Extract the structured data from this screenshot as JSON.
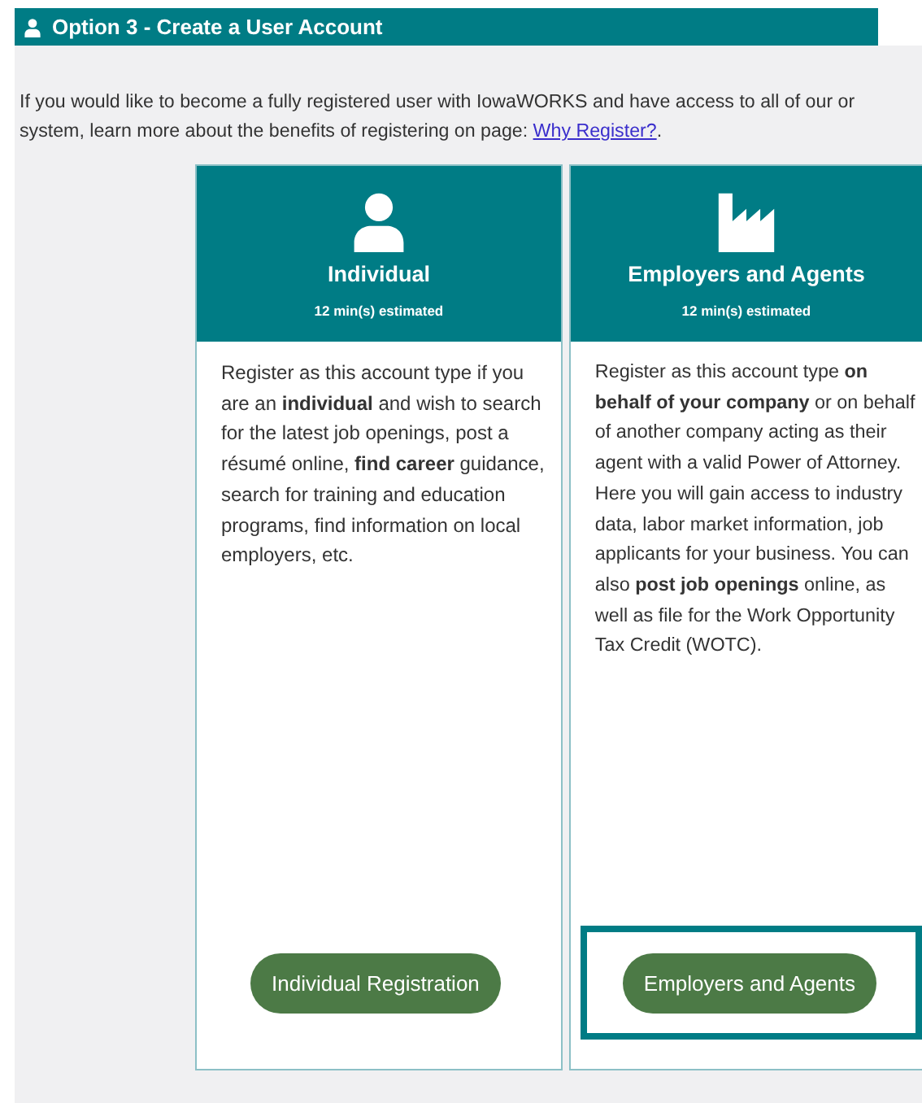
{
  "header": {
    "title": "Option 3 - Create a User Account"
  },
  "intro": {
    "text": "If you would like to become a fully registered user with IowaWORKS and have access to all of our or",
    "text_2": "system, learn more about the benefits of registering on page: ",
    "link": "Why Register?",
    "after": "."
  },
  "cards": [
    {
      "kind": "person",
      "title": "Individual",
      "estimate": "12 min(s) estimated",
      "description": "Register as this account type if you are an **individual** and wish to search for the latest job openings, post a résumé online, **find career** guidance, search for training and education programs, find information on local employers, etc.",
      "button": "Individual Registration",
      "focused": false
    },
    {
      "kind": "factory",
      "title": "Employers and Agents",
      "estimate": "12 min(s) estimated",
      "description": "Register as this account type **on behalf of your company** or on behalf of another company acting as their agent with a valid Power of Attorney. Here you will gain access to industry data, labor market information, job applicants for your business. You can also **post job openings** online, as well as file for the Work Opportunity Tax Credit (WOTC).",
      "button": "Employers and Agents",
      "focused": true
    }
  ]
}
